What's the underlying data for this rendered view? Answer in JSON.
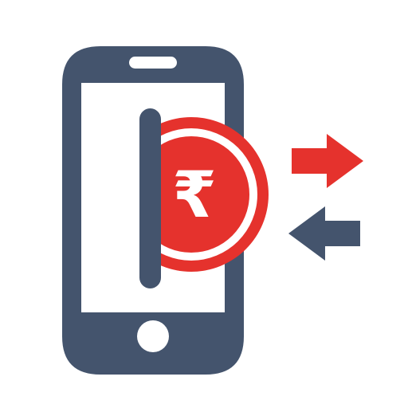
{
  "icon": {
    "name": "mobile-payment-rupee-transfer",
    "currency_symbol": "₹",
    "colors": {
      "phone": "#44546d",
      "accent": "#e5322d",
      "background": "#ffffff"
    },
    "parts": [
      "phone-icon",
      "rupee-coin-icon",
      "arrow-right-icon",
      "arrow-left-icon"
    ]
  }
}
